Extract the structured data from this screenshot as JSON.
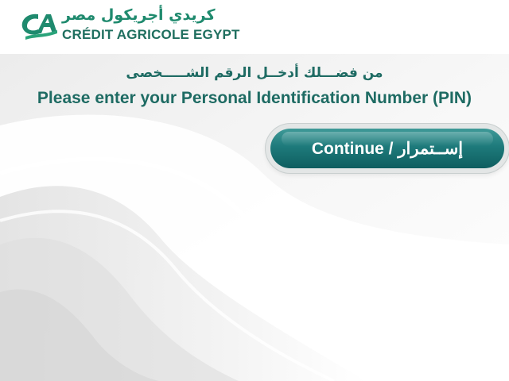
{
  "brand": {
    "name_arabic": "كريدي أجريكول مصر",
    "name_english": "CRÉDIT AGRICOLE EGYPT",
    "logo_icon": "credit-agricole-logo-icon",
    "color_primary": "#1f6f5f",
    "color_accent": "#2aa37a"
  },
  "prompt": {
    "arabic": "من فضـــلك أدخــل الرقم الشـــــخصى",
    "english": "Please enter your Personal Identification Number (PIN)",
    "color": "#1e6b63"
  },
  "actions": {
    "continue_label": "Continue / إســتمرار",
    "button_color": "#1e7a7b"
  }
}
